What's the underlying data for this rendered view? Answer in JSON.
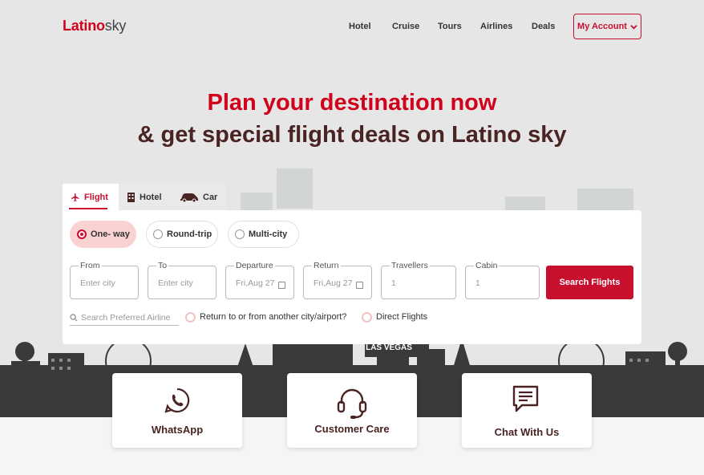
{
  "brand": {
    "name_part1": "Latino",
    "name_part2": "sky"
  },
  "nav": {
    "hotel": "Hotel",
    "cruise": "Cruise",
    "tours": "Tours",
    "airlines": "Airlines",
    "deals": "Deals",
    "account": "My Account"
  },
  "hero": {
    "line1": "Plan your destination now",
    "line2": "& get special flight deals on Latino sky"
  },
  "skyline_sign": "LAS VEGAS",
  "tabs": {
    "flight": "Flight",
    "hotel": "Hotel",
    "car": "Car"
  },
  "trip_types": {
    "one_way": "One- way",
    "round_trip": "Round-trip",
    "multi_city": "Multi-city",
    "selected": "one_way"
  },
  "fields": {
    "from": {
      "label": "From",
      "placeholder": "Enter city"
    },
    "to": {
      "label": "To",
      "placeholder": "Enter city"
    },
    "departure": {
      "label": "Departure",
      "value": "Fri,Aug 27"
    },
    "return": {
      "label": "Return",
      "value": "Fri,Aug 27"
    },
    "travellers": {
      "label": "Travellers",
      "value": "1"
    },
    "cabin": {
      "label": "Cabin",
      "value": "1"
    }
  },
  "search_button": "Search Flights",
  "airline_search": {
    "placeholder": "Search Preferred Airline"
  },
  "options": {
    "return_other": "Return to or from another city/airport?",
    "direct": "Direct Flights"
  },
  "cards": {
    "whatsapp": "WhatsApp",
    "customer_care": "Customer Care",
    "chat": "Chat With Us"
  },
  "colors": {
    "accent": "#c8102e",
    "heading": "#4a2323",
    "bg": "#e6e6e6"
  }
}
